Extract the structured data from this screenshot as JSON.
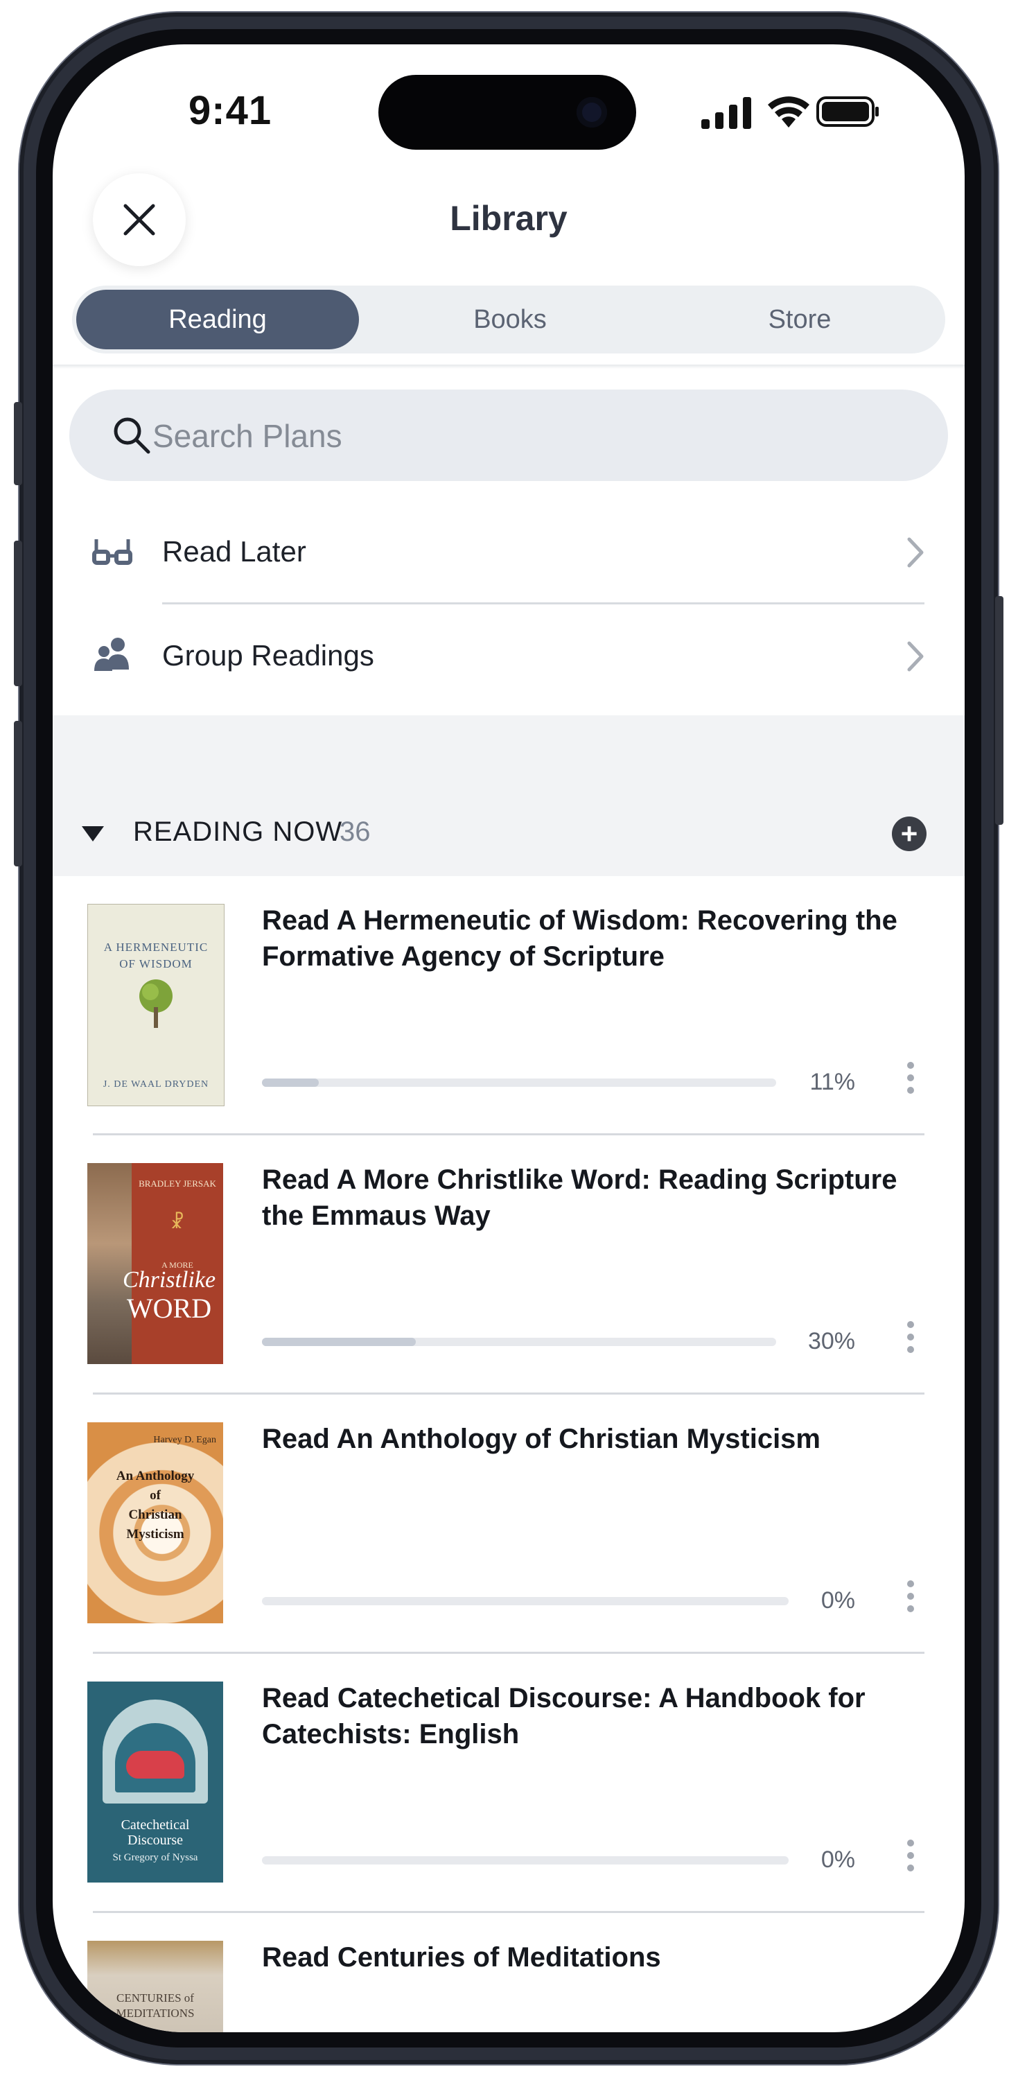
{
  "status_bar": {
    "time": "9:41"
  },
  "header": {
    "title": "Library"
  },
  "tabs": [
    {
      "label": "Reading",
      "active": true
    },
    {
      "label": "Books",
      "active": false
    },
    {
      "label": "Store",
      "active": false
    }
  ],
  "search": {
    "placeholder": "Search Plans"
  },
  "links": [
    {
      "label": "Read Later",
      "icon": "glasses-icon"
    },
    {
      "label": "Group Readings",
      "icon": "group-icon"
    }
  ],
  "section": {
    "title": "READING NOW",
    "count": "36"
  },
  "plans": [
    {
      "title": "Read A Hermeneutic of Wisdom: Recovering the Formative Agency of Scripture",
      "percent_label": "11%",
      "progress": 0.11,
      "cover": {
        "line1": "A HERMENEUTIC",
        "line2": "OF WISDOM",
        "author": "J. DE WAAL DRYDEN"
      }
    },
    {
      "title": "Read A More Christlike Word: Reading Scripture the Emmaus Way",
      "percent_label": "30%",
      "progress": 0.3,
      "cover": {
        "author": "BRADLEY JERSAK",
        "line1": "A MORE",
        "line2": "Christlike",
        "line3": "WORD"
      }
    },
    {
      "title": "Read An Anthology of Christian Mysticism",
      "percent_label": "0%",
      "progress": 0.0,
      "cover": {
        "author": "Harvey D. Egan",
        "line1": "An Anthology",
        "line2": "of",
        "line3": "Christian",
        "line4": "Mysticism"
      }
    },
    {
      "title": "Read Catechetical Discourse: A Handbook for Catechists: English",
      "percent_label": "0%",
      "progress": 0.0,
      "cover": {
        "line1": "Catechetical",
        "line2": "Discourse",
        "author": "St Gregory of Nyssa"
      }
    },
    {
      "title": "Read Centuries of Meditations",
      "cover": {
        "line1": "CENTURIES of",
        "line2": "MEDITATIONS"
      }
    }
  ]
}
